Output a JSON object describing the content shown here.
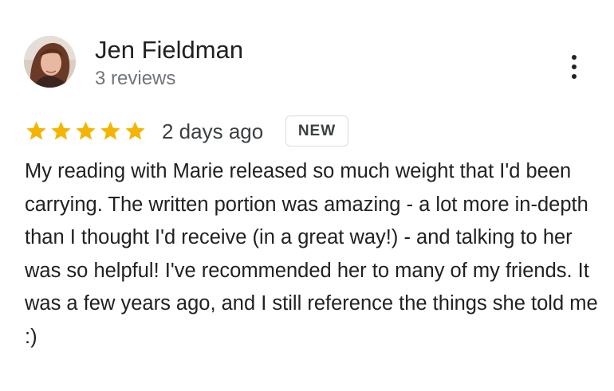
{
  "review": {
    "author": {
      "name": "Jen Fieldman",
      "review_count": "3 reviews",
      "avatar_icon": "profile-photo"
    },
    "menu_icon": "more-vert-icon",
    "rating": 5,
    "rating_max": 5,
    "star_color": "#f4b400",
    "date": "2 days ago",
    "badge": "NEW",
    "text": "My reading with Marie released so much weight that I'd been carrying. The written portion was amazing - a lot more in-depth than I thought I'd receive (in a great way!) - and talking to her was so helpful! I've recommended her to many of my friends. It was a few years ago, and I still reference the things she told me :)"
  }
}
